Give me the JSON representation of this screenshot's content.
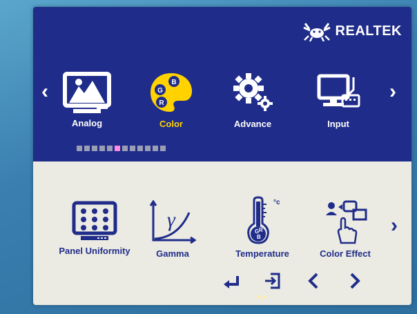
{
  "brand": {
    "name": "REALTEK",
    "icon": "realtek-crab-icon"
  },
  "main_menu": {
    "items": [
      {
        "label": "Analog",
        "icon": "landscape-monitor-icon",
        "active": false
      },
      {
        "label": "Color",
        "icon": "color-palette-icon",
        "active": true,
        "palette_letters": [
          "G",
          "B",
          "R"
        ]
      },
      {
        "label": "Advance",
        "icon": "gears-icon",
        "active": false
      },
      {
        "label": "Input",
        "icon": "pc-input-icon",
        "active": false
      }
    ],
    "prev_icon": "chevron-left-icon",
    "next_icon": "chevron-right-icon",
    "page_indicator": {
      "total": 12,
      "active_index": 5
    }
  },
  "sub_menu": {
    "items": [
      {
        "label": "Panel Uniformity",
        "icon": "panel-grid-icon"
      },
      {
        "label": "Gamma",
        "icon": "gamma-curve-icon",
        "symbol": "γ"
      },
      {
        "label": "Temperature",
        "icon": "thermometer-icon",
        "unit": "°c",
        "letters": [
          "G",
          "R",
          "B"
        ]
      },
      {
        "label": "Color Effect",
        "icon": "color-effect-icon"
      }
    ],
    "next_icon": "chevron-right-icon"
  },
  "nav_keys": [
    {
      "icon": "enter-icon"
    },
    {
      "icon": "exit-icon"
    },
    {
      "icon": "left-arrow-icon"
    },
    {
      "icon": "right-arrow-icon"
    }
  ],
  "colors": {
    "top_panel": "#1f2c8a",
    "bottom_panel": "#ecebe3",
    "active_label": "#ffd200",
    "indicator_active": "#ff8be2"
  }
}
